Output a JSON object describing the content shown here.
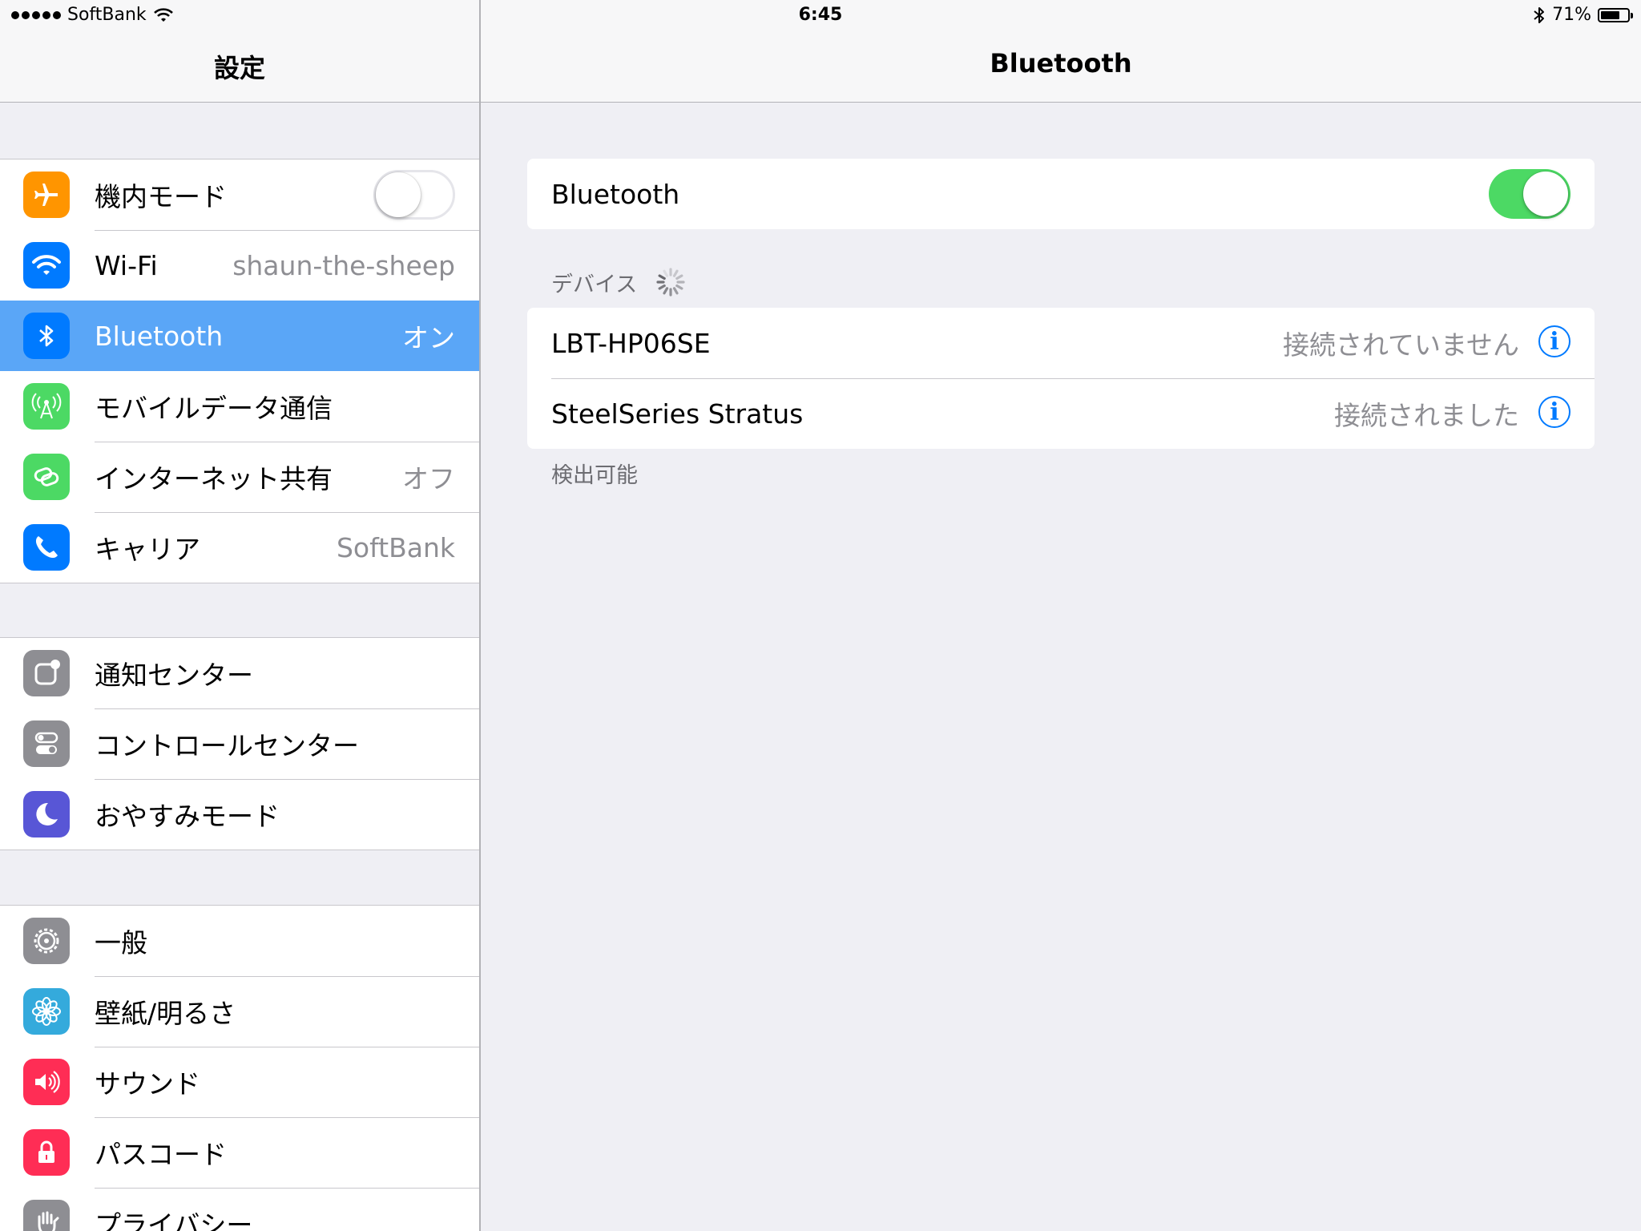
{
  "status_bar": {
    "carrier": "SoftBank",
    "time": "6:45",
    "battery": "71%",
    "battery_level": 0.71,
    "icons": [
      "signal-dots",
      "wifi-icon",
      "bluetooth-icon",
      "battery-icon"
    ]
  },
  "left_pane": {
    "title": "設定",
    "groups": [
      {
        "items": [
          {
            "label": "機内モード",
            "icon": "airplane-icon",
            "color": "#ff9500",
            "toggle": "off"
          },
          {
            "label": "Wi-Fi",
            "value": "shaun-the-sheep",
            "icon": "wifi-icon",
            "color": "#007aff"
          },
          {
            "label": "Bluetooth",
            "value": "オン",
            "icon": "bluetooth-icon",
            "color": "#007aff",
            "selected": true
          },
          {
            "label": "モバイルデータ通信",
            "icon": "antenna-icon",
            "color": "#4cd964"
          },
          {
            "label": "インターネット共有",
            "value": "オフ",
            "icon": "chain-icon",
            "color": "#4cd964"
          },
          {
            "label": "キャリア",
            "value": "SoftBank",
            "icon": "phone-icon",
            "color": "#007aff"
          }
        ]
      },
      {
        "items": [
          {
            "label": "通知センター",
            "icon": "notification-icon",
            "color": "#8e8e93"
          },
          {
            "label": "コントロールセンター",
            "icon": "control-center-icon",
            "color": "#8e8e93"
          },
          {
            "label": "おやすみモード",
            "icon": "moon-icon",
            "color": "#5856d6"
          }
        ]
      },
      {
        "items": [
          {
            "label": "一般",
            "icon": "gear-icon",
            "color": "#8e8e93"
          },
          {
            "label": "壁紙/明るさ",
            "icon": "flower-icon",
            "color": "#34aadc"
          },
          {
            "label": "サウンド",
            "icon": "speaker-icon",
            "color": "#ff2d55"
          },
          {
            "label": "パスコード",
            "icon": "lock-icon",
            "color": "#ff2d55"
          },
          {
            "label": "プライバシー",
            "icon": "hand-icon",
            "color": "#8e8e93"
          }
        ]
      }
    ]
  },
  "right_pane": {
    "title": "Bluetooth",
    "bluetooth_toggle": {
      "label": "Bluetooth",
      "state": "on"
    },
    "devices_header": "デバイス",
    "devices": [
      {
        "name": "LBT-HP06SE",
        "status": "接続されていません"
      },
      {
        "name": "SteelSeries Stratus",
        "status": "接続されました"
      }
    ],
    "info_glyph": "i",
    "footer": "検出可能"
  },
  "colors": {
    "selected": "#5aa6f7",
    "toggle_on": "#4cd964",
    "tint": "#007aff",
    "background": "#efeff4"
  }
}
